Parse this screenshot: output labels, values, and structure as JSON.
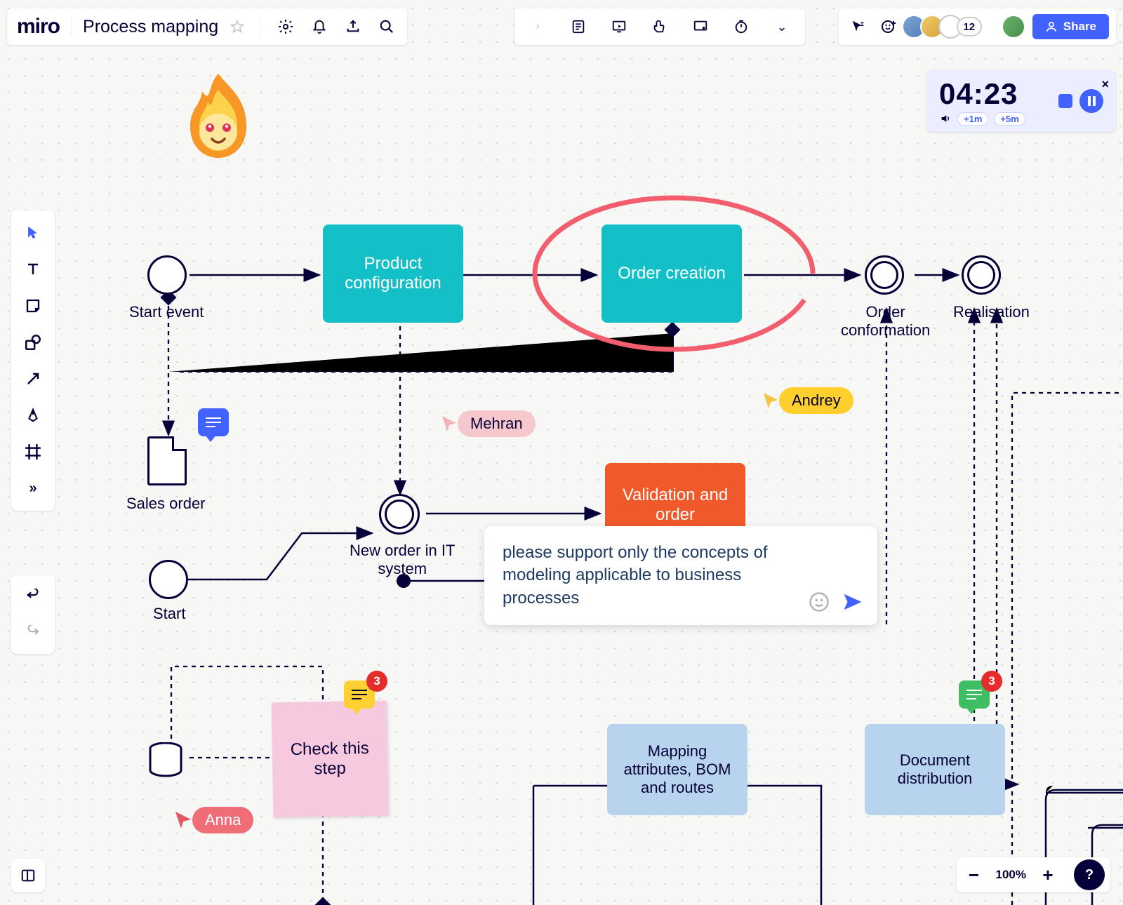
{
  "app": {
    "logo": "miro",
    "board_title": "Process mapping"
  },
  "topbar_right": {
    "collaborator_count": "12",
    "share_label": "Share"
  },
  "timer": {
    "value": "04:23",
    "add1": "+1m",
    "add5": "+5m"
  },
  "zoom": {
    "level": "100%"
  },
  "flow": {
    "start_event_label": "Start event",
    "product_config": "Product\nconfiguration",
    "order_creation": "Order creation",
    "order_conformation": "Order\nconformation",
    "realisation": "Realisation",
    "sales_order": "Sales order",
    "new_order": "New order in IT\nsystem",
    "start": "Start",
    "validation": "Validation and\norder",
    "mapping": "Mapping\nattributes, BOM\nand routes",
    "doc_dist": "Document\ndistribution",
    "check_step": "Check this\nstep"
  },
  "cursors": {
    "mehran": "Mehran",
    "andrey": "Andrey",
    "anna": "Anna"
  },
  "comment": {
    "text": "please support only the concepts of modeling applicable to business processes",
    "badge_yellow": "3",
    "badge_green": "3"
  },
  "help": {
    "label": "?"
  }
}
